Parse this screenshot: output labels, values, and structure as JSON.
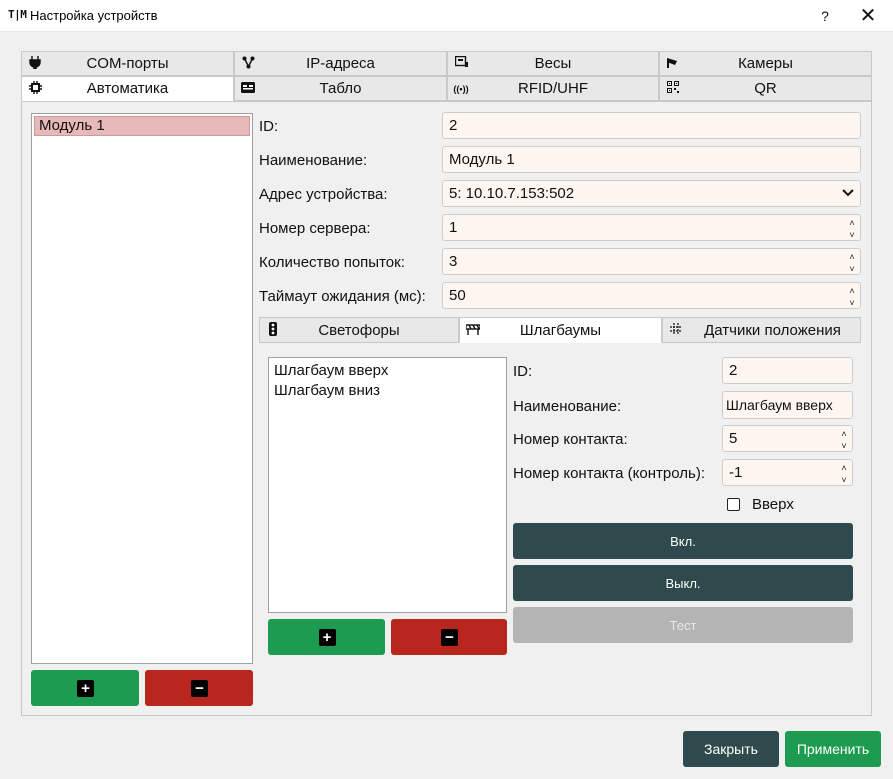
{
  "window": {
    "logo": "T|M",
    "title": "Настройка устройств",
    "help": "?",
    "close": "✕"
  },
  "main_tabs": [
    {
      "label": "COM-порты",
      "icon": "plug-icon",
      "glyph": "⏚"
    },
    {
      "label": "IP-адреса",
      "icon": "network-icon",
      "glyph": "⚯"
    },
    {
      "label": "Весы",
      "icon": "scale-icon",
      "glyph": "▤"
    },
    {
      "label": "Камеры",
      "icon": "camera-icon",
      "glyph": "◣"
    },
    {
      "label": "Автоматика",
      "icon": "chip-icon",
      "glyph": "✲"
    },
    {
      "label": "Табло",
      "icon": "display-icon",
      "glyph": "▬"
    },
    {
      "label": "RFID/UHF",
      "icon": "rfid-icon",
      "glyph": "((•))"
    },
    {
      "label": "QR",
      "icon": "qr-icon",
      "glyph": "▦"
    }
  ],
  "active_main_tab": "Автоматика",
  "modules": {
    "items": [
      "Модуль 1"
    ],
    "selected": "Модуль 1"
  },
  "module_form": {
    "id_label": "ID:",
    "id_value": "2",
    "name_label": "Наименование:",
    "name_value": "Модуль 1",
    "address_label": "Адрес устройства:",
    "address_value": "5: 10.10.7.153:502",
    "server_label": "Номер сервера:",
    "server_value": "1",
    "attempts_label": "Количество попыток:",
    "attempts_value": "3",
    "timeout_label": "Таймаут ожидания (мс):",
    "timeout_value": "50"
  },
  "sub_tabs": [
    {
      "label": "Светофоры",
      "icon": "traffic-light-icon"
    },
    {
      "label": "Шлагбаумы",
      "icon": "barrier-icon"
    },
    {
      "label": "Датчики положения",
      "icon": "sensor-grid-icon"
    }
  ],
  "active_sub_tab": "Шлагбаумы",
  "barriers": {
    "items": [
      "Шлагбаум вверх",
      "Шлагбаум вниз"
    ]
  },
  "barrier_form": {
    "id_label": "ID:",
    "id_value": "2",
    "name_label": "Наименование:",
    "name_value": "Шлагбаум вверх",
    "contact_label": "Номер контакта:",
    "contact_value": "5",
    "contact_ctrl_label": "Номер контакта (контроль):",
    "contact_ctrl_value": "-1",
    "up_label": "Вверх",
    "up_checked": false,
    "on_label": "Вкл.",
    "off_label": "Выкл.",
    "test_label": "Тест"
  },
  "footer": {
    "close_label": "Закрыть",
    "apply_label": "Применить"
  },
  "colors": {
    "green": "#1d9b50",
    "red": "#b8261e",
    "dark": "#2e4a4c",
    "field_bg": "#fdf5f0",
    "selection": "#e8b9b9"
  }
}
